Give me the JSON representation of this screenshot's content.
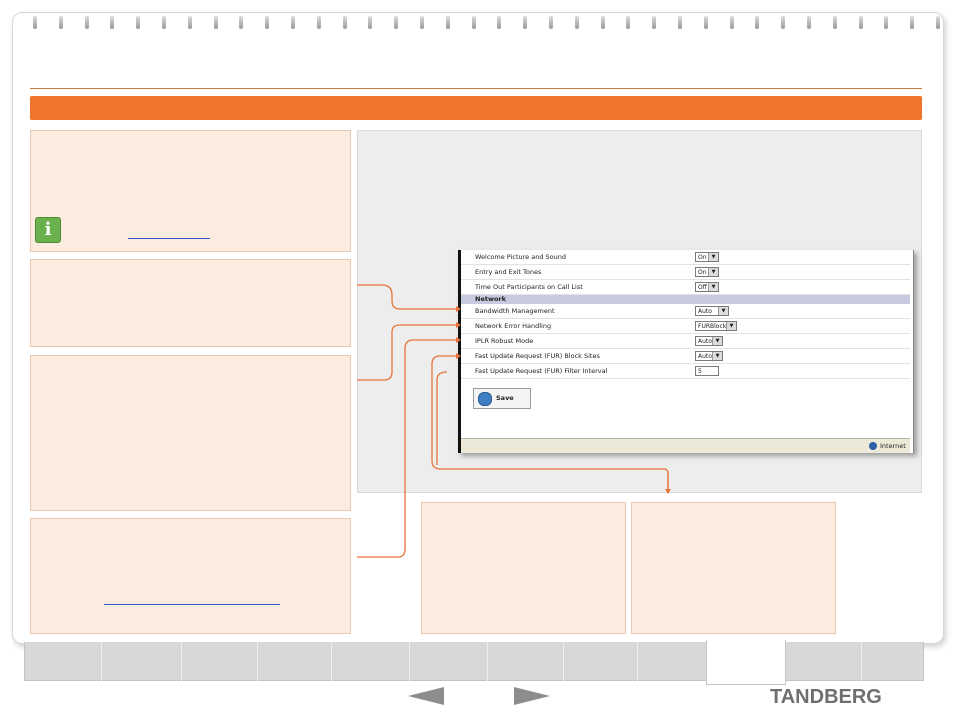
{
  "settings_screenshot": {
    "rows_top": [
      {
        "label": "Welcome Picture and Sound",
        "value": "On"
      },
      {
        "label": "Entry and Exit Tones",
        "value": "On"
      },
      {
        "label": "Time Out Participants on Call List",
        "value": "Off"
      }
    ],
    "section_header": "Network",
    "rows_network": [
      {
        "label": "Bandwidth Management",
        "value": "Auto"
      },
      {
        "label": "Network Error Handling",
        "value": "FURBlock"
      },
      {
        "label": "IPLR Robust Mode",
        "value": "Auto"
      },
      {
        "label": "Fast Update Request (FUR) Block Sites",
        "value": "Auto"
      },
      {
        "label": "Fast Update Request (FUR) Filter Interval",
        "value": "5"
      }
    ],
    "save_label": "Save",
    "status_zone": "Internet"
  },
  "footer": {
    "brand": "TANDBERG"
  },
  "colors": {
    "accent_orange": "#f2742b",
    "panel_fill": "#fcebdf",
    "connector_line": "#e8743b"
  },
  "icons": {
    "info": "info-icon",
    "save": "save-icon",
    "globe": "globe-icon",
    "prev": "arrow-left-icon",
    "next": "arrow-right-icon"
  }
}
